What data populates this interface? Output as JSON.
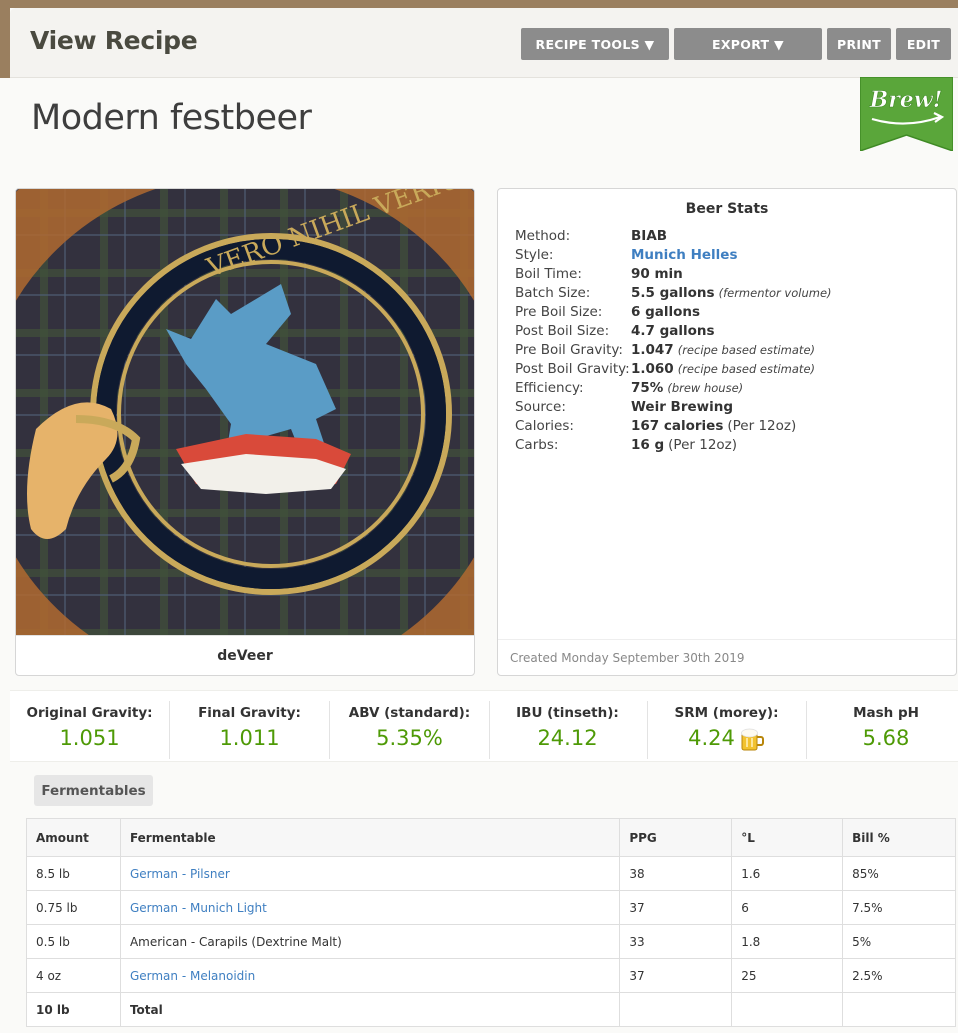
{
  "header": {
    "title": "View Recipe",
    "buttons": {
      "recipe_tools": "RECIPE TOOLS ▼",
      "export": "EXPORT ▼",
      "print": "PRINT",
      "edit": "EDIT"
    }
  },
  "recipe": {
    "name": "Modern festbeer",
    "brew_badge": "Brew!",
    "image_caption": "deVeer",
    "image_motto": "VERO NIHIL VERIUS"
  },
  "beer_stats": {
    "title": "Beer Stats",
    "rows": [
      {
        "label": "Method:",
        "value": "BIAB",
        "note": ""
      },
      {
        "label": "Style:",
        "value": "Munich Helles",
        "note": ""
      },
      {
        "label": "Boil Time:",
        "value": "90 min",
        "note": ""
      },
      {
        "label": "Batch Size:",
        "value": "5.5 gallons",
        "note": "(fermentor volume)"
      },
      {
        "label": "Pre Boil Size:",
        "value": "6 gallons",
        "note": ""
      },
      {
        "label": "Post Boil Size:",
        "value": "4.7 gallons",
        "note": ""
      },
      {
        "label": "Pre Boil Gravity:",
        "value": "1.047",
        "note": "(recipe based estimate)"
      },
      {
        "label": "Post Boil Gravity:",
        "value": "1.060",
        "note": "(recipe based estimate)"
      },
      {
        "label": "Efficiency:",
        "value": "75%",
        "note": "(brew house)"
      },
      {
        "label": "Source:",
        "value": "Weir Brewing",
        "note": ""
      },
      {
        "label": "Calories:",
        "value": "167 calories",
        "note": "(Per 12oz)"
      },
      {
        "label": "Carbs:",
        "value": "16 g",
        "note": "(Per 12oz)"
      }
    ],
    "created": "Created Monday September 30th 2019"
  },
  "summary": [
    {
      "label": "Original Gravity:",
      "value": "1.051"
    },
    {
      "label": "Final Gravity:",
      "value": "1.011"
    },
    {
      "label": "ABV (standard):",
      "value": "5.35%"
    },
    {
      "label": "IBU (tinseth):",
      "value": "24.12"
    },
    {
      "label": "SRM (morey):",
      "value": "4.24"
    },
    {
      "label": "Mash pH",
      "value": "5.68"
    }
  ],
  "fermentables": {
    "tab_label": "Fermentables",
    "columns": [
      "Amount",
      "Fermentable",
      "PPG",
      "°L",
      "Bill %"
    ],
    "rows": [
      {
        "amount": "8.5 lb",
        "name": "German - Pilsner",
        "ppg": "38",
        "lovibond": "1.6",
        "bill": "85%"
      },
      {
        "amount": "0.75 lb",
        "name": "German - Munich Light",
        "ppg": "37",
        "lovibond": "6",
        "bill": "7.5%"
      },
      {
        "amount": "0.5 lb",
        "name": "American - Carapils (Dextrine Malt)",
        "ppg": "33",
        "lovibond": "1.8",
        "bill": "5%"
      },
      {
        "amount": "4 oz",
        "name": "German - Melanoidin",
        "ppg": "37",
        "lovibond": "25",
        "bill": "2.5%"
      }
    ],
    "total": {
      "amount": "10 lb",
      "label": "Total"
    }
  },
  "colors": {
    "accent_green": "#4e9a06",
    "link_blue": "#3f7fc1",
    "button_gray": "#8c8c8c",
    "brew_green": "#5aa63a"
  }
}
